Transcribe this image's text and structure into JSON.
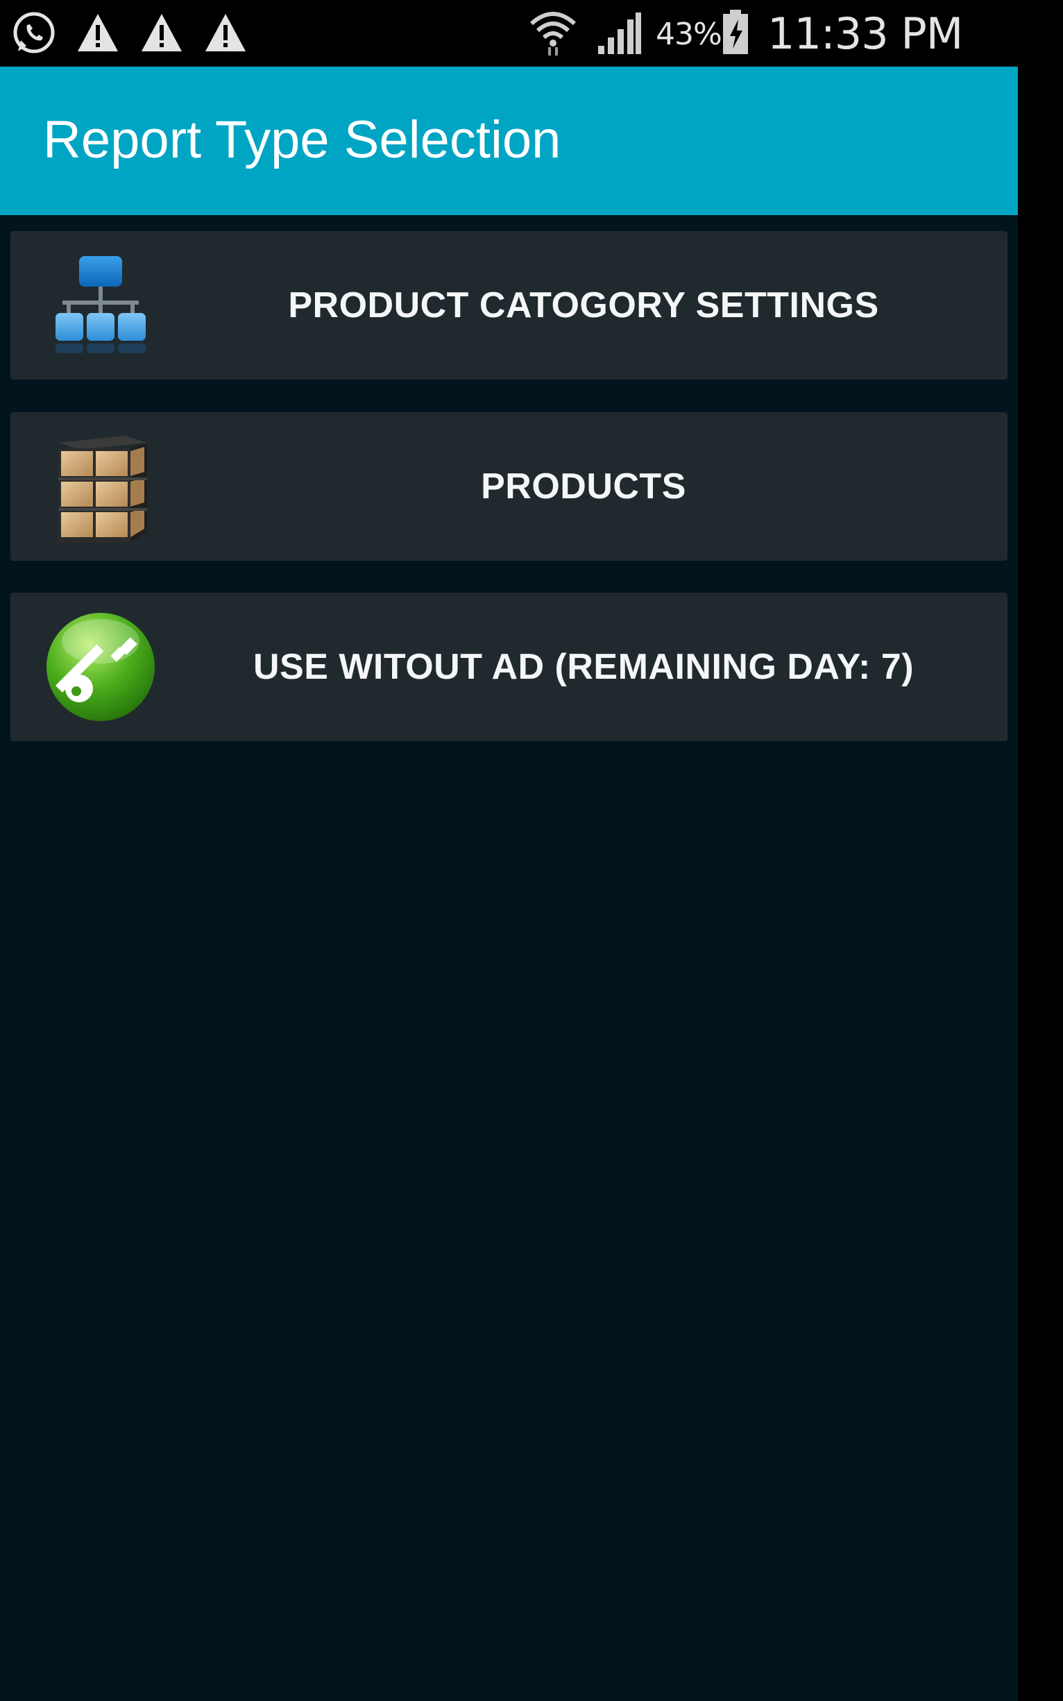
{
  "status_bar": {
    "battery_percent": "43%",
    "time": "11:33 PM",
    "left_icons": [
      "whatsapp-icon",
      "warning-icon",
      "warning-icon",
      "warning-icon"
    ],
    "right_icons": [
      "wifi-icon",
      "signal-icon",
      "battery-charging-icon"
    ]
  },
  "action_bar": {
    "title": "Report Type Selection",
    "color": "#00a5c3"
  },
  "menu": {
    "items": [
      {
        "label": "PRODUCT CATOGORY SETTINGS",
        "icon": "hierarchy-icon"
      },
      {
        "label": "PRODUCTS",
        "icon": "boxes-shelf-icon"
      },
      {
        "label": "USE WITOUT AD (REMAINING DAY: 7)",
        "icon": "key-icon"
      }
    ]
  },
  "colors": {
    "background": "#02141c",
    "item_background": "#202a2e",
    "text": "#f4f6f7"
  }
}
